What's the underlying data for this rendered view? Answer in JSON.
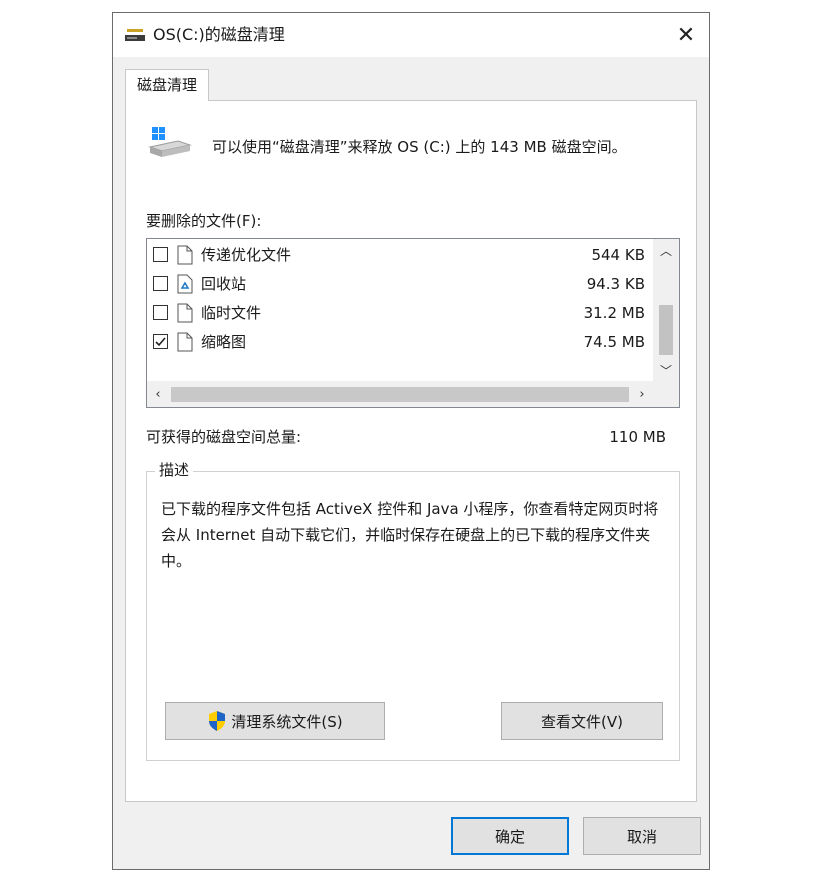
{
  "window": {
    "title": "OS(C:)的磁盘清理",
    "icon": "disk-cleanup-icon",
    "close_label": "✕"
  },
  "tab": {
    "label": "磁盘清理"
  },
  "header": {
    "message": "可以使用“磁盘清理”来释放 OS (C:) 上的 143 MB 磁盘空间。"
  },
  "files": {
    "label": "要删除的文件(F):",
    "items": [
      {
        "name": "传递优化文件",
        "size": "544 KB",
        "checked": false,
        "icon": "file-icon"
      },
      {
        "name": "回收站",
        "size": "94.3 KB",
        "checked": false,
        "icon": "recycle-bin-icon"
      },
      {
        "name": "临时文件",
        "size": "31.2 MB",
        "checked": false,
        "icon": "file-icon"
      },
      {
        "name": "缩略图",
        "size": "74.5 MB",
        "checked": true,
        "icon": "file-icon"
      }
    ]
  },
  "total": {
    "label": "可获得的磁盘空间总量:",
    "value": "110 MB"
  },
  "description": {
    "legend": "描述",
    "text": "已下载的程序文件包括 ActiveX 控件和 Java 小程序，你查看特定网页时将会从 Internet 自动下载它们，并临时保存在硬盘上的已下载的程序文件夹中。"
  },
  "buttons": {
    "clean_system": "清理系统文件(S)",
    "view_files": "查看文件(V)",
    "ok": "确定",
    "cancel": "取消"
  },
  "colors": {
    "accent": "#0078d7",
    "window_bg": "#f0f0f0",
    "panel_bg": "#ffffff"
  }
}
